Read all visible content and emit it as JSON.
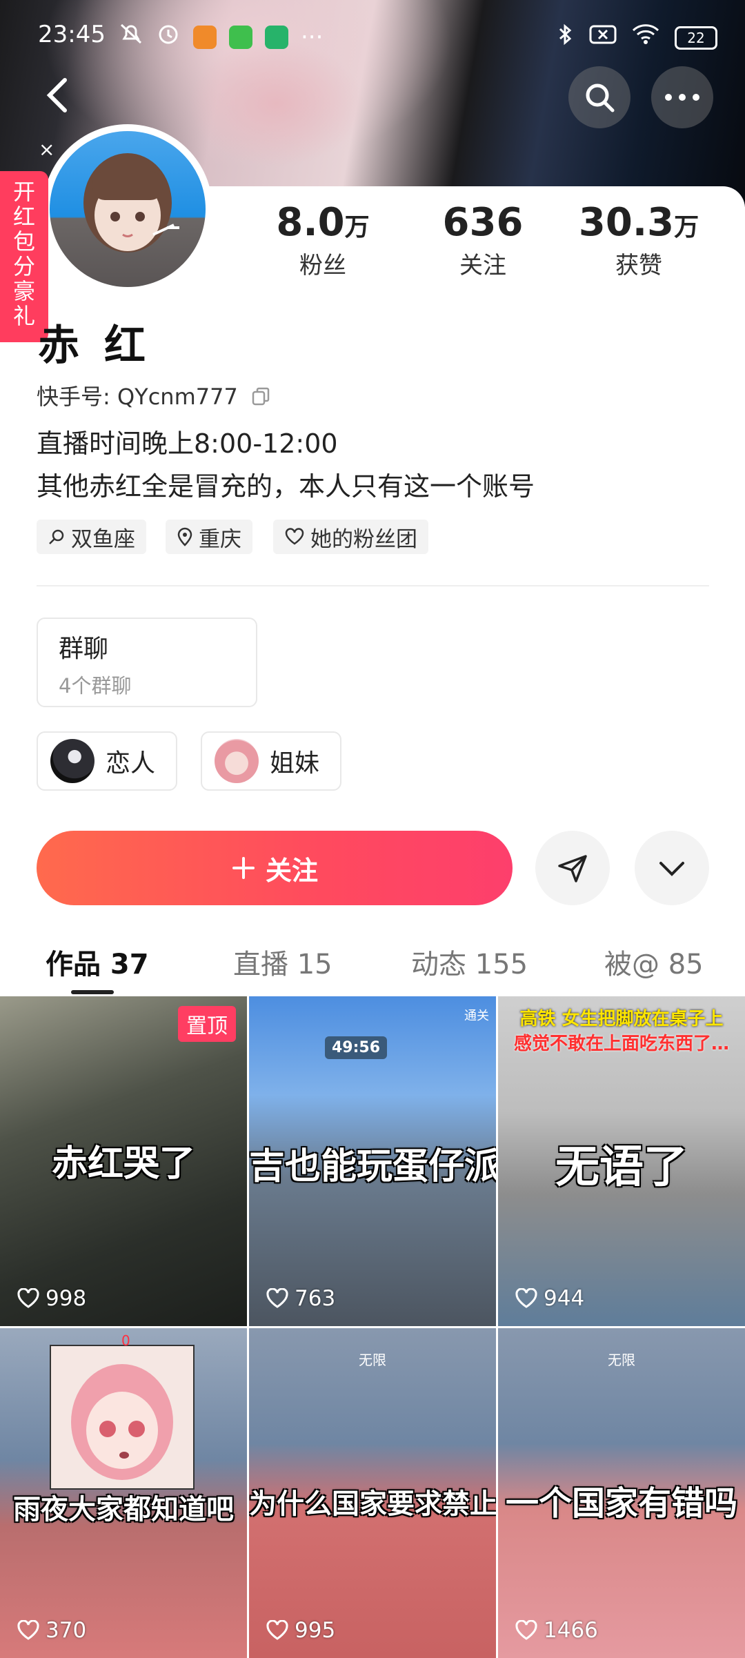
{
  "status_bar": {
    "time": "23:45",
    "battery": "22"
  },
  "side_banner": {
    "text": "开红包分豪礼"
  },
  "profile": {
    "name": "赤红",
    "kuaishou_id": "快手号: QYcnm777",
    "bio_lines": [
      "直播时间晚上8:00-12:00",
      "其他赤红全是冒充的，本人只有这一个账号"
    ],
    "tags": [
      "双鱼座",
      "重庆",
      "她的粉丝团"
    ]
  },
  "stats": [
    {
      "num": "8.0",
      "unit": "万",
      "label": "粉丝"
    },
    {
      "num": "636",
      "unit": "",
      "label": "关注"
    },
    {
      "num": "30.3",
      "unit": "万",
      "label": "获赞"
    }
  ],
  "group_chat": {
    "title": "群聊",
    "subtitle": "4个群聊"
  },
  "relations": [
    {
      "label": "恋人"
    },
    {
      "label": "姐妹"
    }
  ],
  "follow_button": {
    "label": "关注",
    "icon": "plus-icon"
  },
  "tabs": [
    "作品 37",
    "直播 15",
    "动态 155",
    "被@ 85"
  ],
  "videos": [
    {
      "caption": "赤红哭了",
      "likes": "998",
      "pinned": "置顶"
    },
    {
      "caption": "吉也能玩蛋仔派对",
      "likes": "763",
      "overlay_timer": "49:56",
      "overlay_note": "通关"
    },
    {
      "caption": "无语了",
      "likes": "944",
      "top_text_1": "高铁 女生把脚放在桌子上",
      "top_text_2": "感觉不敢在上面吃东西了…"
    },
    {
      "caption": "雨夜大家都知道吧",
      "likes": "370",
      "hud": "0"
    },
    {
      "caption": "为什么国家要求禁止乘",
      "likes": "995",
      "hud": "无限"
    },
    {
      "caption": "一个国家有错吗",
      "likes": "1466",
      "hud": "无限"
    }
  ],
  "colors": {
    "accent": "#ff4a5e",
    "pin": "#ff3e62",
    "side_banner": "#ff3d5e"
  }
}
